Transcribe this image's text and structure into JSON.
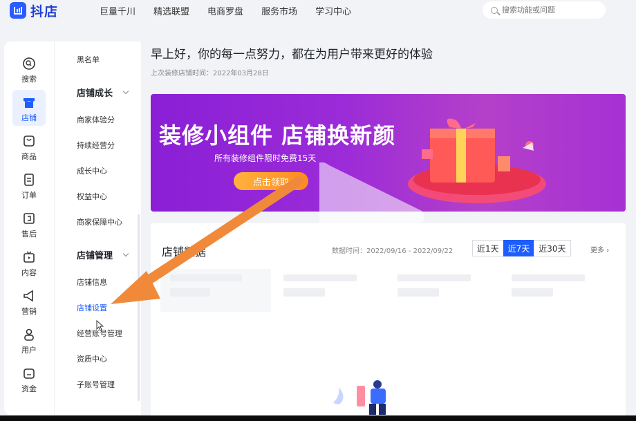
{
  "app": {
    "logo_text": "抖店"
  },
  "topnav": [
    "巨量千川",
    "精选联盟",
    "电商罗盘",
    "服务市场",
    "学习中心"
  ],
  "search": {
    "placeholder": "搜索功能或问题"
  },
  "rail": [
    {
      "label": "搜索",
      "icon": "search-icon"
    },
    {
      "label": "店铺",
      "icon": "shop-icon",
      "active": true
    },
    {
      "label": "商品",
      "icon": "product-icon"
    },
    {
      "label": "订单",
      "icon": "order-icon"
    },
    {
      "label": "售后",
      "icon": "aftersale-icon"
    },
    {
      "label": "内容",
      "icon": "content-icon"
    },
    {
      "label": "营销",
      "icon": "megaphone-icon"
    },
    {
      "label": "用户",
      "icon": "user-icon"
    },
    {
      "label": "资金",
      "icon": "wallet-icon"
    }
  ],
  "submenu": {
    "top_item": "黑名单",
    "group1": "店铺成长",
    "group1_items": [
      "商家体验分",
      "持续经营分",
      "成长中心",
      "权益中心",
      "商家保障中心"
    ],
    "group2": "店铺管理",
    "group2_items": [
      "店铺信息",
      "店铺设置",
      "经营账号管理",
      "资质中心",
      "子账号管理"
    ],
    "active": "店铺设置"
  },
  "main": {
    "greeting": "早上好，你的每一点努力，都在为用户带来更好的体验",
    "last_time": "上次装修店铺时间：2022年03月28日"
  },
  "banner": {
    "title": "装修小组件 店铺换新颜",
    "subtitle": "所有装修组件限时免费15天",
    "button": "点击领取"
  },
  "data_card": {
    "title": "店铺数据",
    "time": "数据时间：2022/09/16 - 2022/09/22",
    "tabs": [
      "近1天",
      "近7天",
      "近30天"
    ],
    "active_tab": "近7天",
    "more": "更多"
  },
  "colors": {
    "brand": "#1e5eff",
    "banner": "#9b2bd8",
    "button": "#ff9a2e",
    "arrow": "#f08a3a"
  }
}
